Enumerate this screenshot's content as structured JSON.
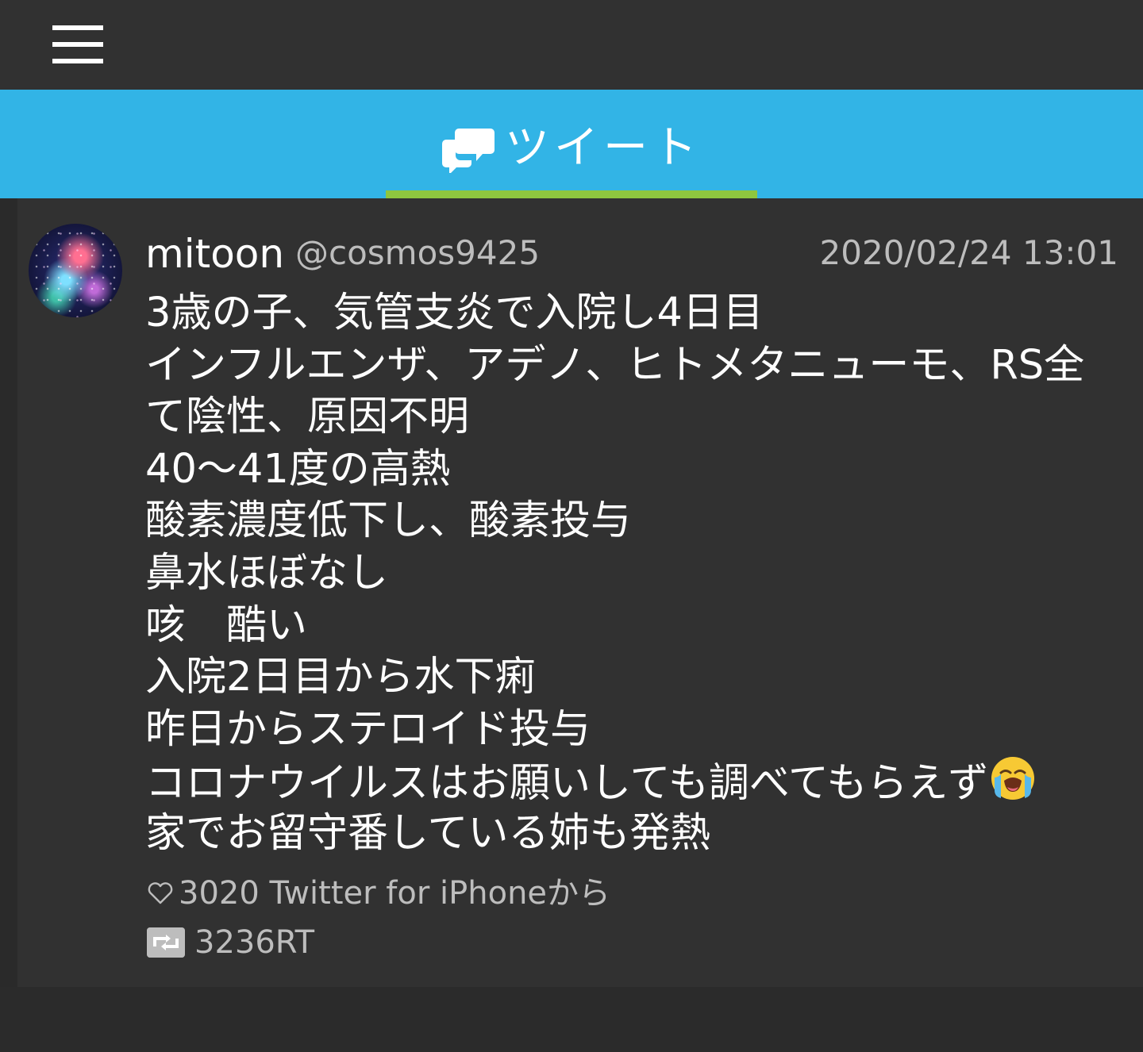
{
  "header": {
    "menu_icon": "hamburger-menu-icon"
  },
  "tabs": [
    {
      "label": "ツイート",
      "icon": "speech-bubbles-icon",
      "active": true
    }
  ],
  "colors": {
    "tab_bar": "#32b4e6",
    "tab_indicator": "#8ec63f",
    "background": "#313131",
    "muted_text": "#bdbdbd"
  },
  "tweet": {
    "user_name": "mitoon",
    "handle": "@cosmos9425",
    "timestamp": "2020/02/24 13:01",
    "lines": [
      "3歳の子、気管支炎で入院し4日目",
      "インフルエンザ、アデノ、ヒトメタニューモ、RS全",
      "て陰性、原因不明",
      "40～41度の高熱",
      "酸素濃度低下し、酸素投与",
      "鼻水ほぼなし",
      "咳　酷い",
      "入院2日目から水下痢",
      "昨日からステロイド投与",
      "コロナウイルスはお願いしても調べてもらえず",
      "家でお留守番している姉も発熱"
    ],
    "emoji": "loudly-crying-face-icon",
    "meta": "3020 Twitter for iPhoneから",
    "retweets": "3236RT"
  }
}
